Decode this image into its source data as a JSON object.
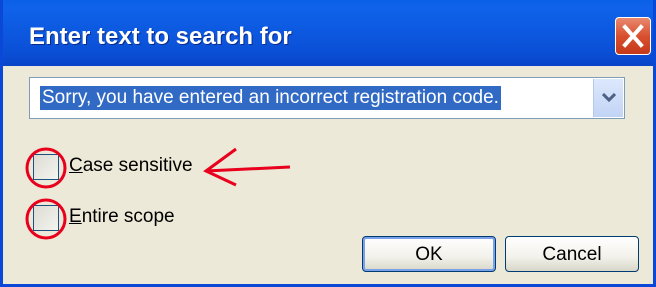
{
  "window": {
    "title": "Enter text to search for",
    "close_icon": "close-icon"
  },
  "search": {
    "value": "Sorry, you have entered an incorrect registration code.",
    "dropdown_icon": "chevron-down-icon"
  },
  "options": [
    {
      "label_first": "C",
      "label_rest": "ase sensitive",
      "checked": false
    },
    {
      "label_first": "E",
      "label_rest": "ntire scope",
      "checked": false
    }
  ],
  "buttons": {
    "ok": "OK",
    "cancel": "Cancel"
  },
  "colors": {
    "titlebar": "#0a5fe8",
    "selection": "#316ac5",
    "annotation": "#e8001c"
  }
}
